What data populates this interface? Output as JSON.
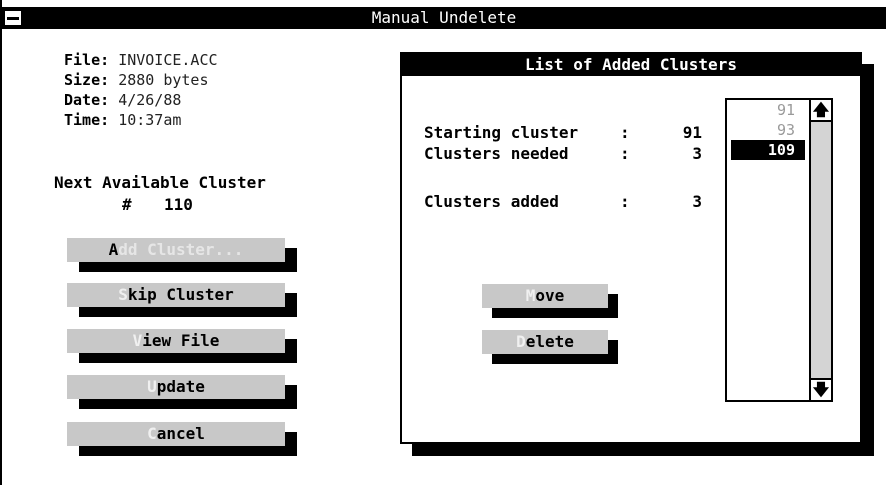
{
  "window": {
    "title": "Manual Undelete"
  },
  "file_info": [
    {
      "label": "File:",
      "value": "INVOICE.ACC"
    },
    {
      "label": "Size:",
      "value": "2880 bytes"
    },
    {
      "label": "Date:",
      "value": "4/26/88"
    },
    {
      "label": "Time:",
      "value": "10:37am"
    }
  ],
  "next_cluster": {
    "label": "Next Available Cluster",
    "hash": "#",
    "number": "110"
  },
  "buttons": {
    "add_cluster": {
      "mnemonic": "A",
      "rest": "dd Cluster..."
    },
    "skip_cluster": {
      "mnemonic": "S",
      "rest": "kip Cluster"
    },
    "view_file": {
      "mnemonic": "V",
      "rest": "iew File"
    },
    "update": {
      "mnemonic": "U",
      "rest": "pdate"
    },
    "cancel": {
      "mnemonic": "C",
      "rest": "ancel"
    }
  },
  "dialog": {
    "title": "List of Added Clusters",
    "starting_cluster": {
      "label": "Starting cluster",
      "colon": ":",
      "value": "91"
    },
    "clusters_needed": {
      "label": "Clusters needed",
      "colon": ":",
      "value": "3"
    },
    "clusters_added": {
      "label": "Clusters added",
      "colon": ":",
      "value": "3"
    },
    "move": {
      "mnemonic": "M",
      "rest": "ove"
    },
    "delete": {
      "mnemonic": "D",
      "rest": "elete"
    },
    "list_items": [
      "91",
      "93",
      "109"
    ],
    "selected_item": "109",
    "scroll_up": "🡅",
    "scroll_down": "🡇"
  }
}
